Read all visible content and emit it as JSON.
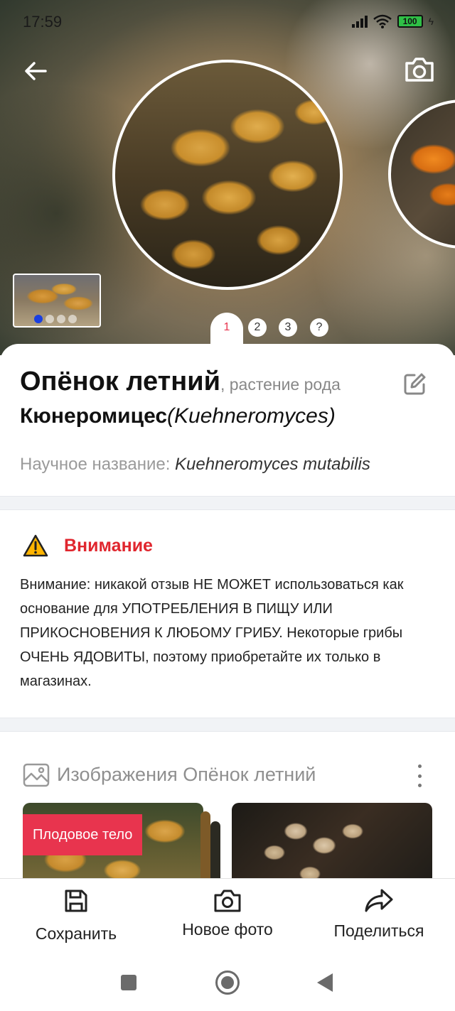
{
  "status_bar": {
    "time": "17:59",
    "battery": "100"
  },
  "hero": {
    "pager": {
      "active": "1",
      "items": [
        "2",
        "3",
        "?"
      ]
    }
  },
  "plant": {
    "name": "Опёнок летний",
    "genus_prefix": ", растение рода",
    "genus": "Кюнеромицес",
    "genus_latin": "(Kuehneromyces)",
    "scientific_label": "Научное название: ",
    "scientific_name": "Kuehneromyces mutabilis"
  },
  "warning": {
    "title": "Внимание",
    "text": "Внимание: никакой отзыв НЕ МОЖЕТ использоваться как основание для УПОТРЕБЛЕНИЯ В ПИЩУ ИЛИ ПРИКОСНОВЕНИЯ К ЛЮБОМУ ГРИБУ. Некоторые грибы ОЧЕНЬ ЯДОВИТЫ, поэтому приобретайте их только в магазинах."
  },
  "gallery": {
    "title": "Изображения Опёнок летний",
    "badge": "Плодовое тело"
  },
  "bottom_bar": {
    "save": "Сохранить",
    "new_photo": "Новое фото",
    "share": "Поделиться"
  },
  "colors": {
    "accent": "#e8344e",
    "warning_red": "#e0262e",
    "pager_dot_active": "#1a3fe0"
  }
}
